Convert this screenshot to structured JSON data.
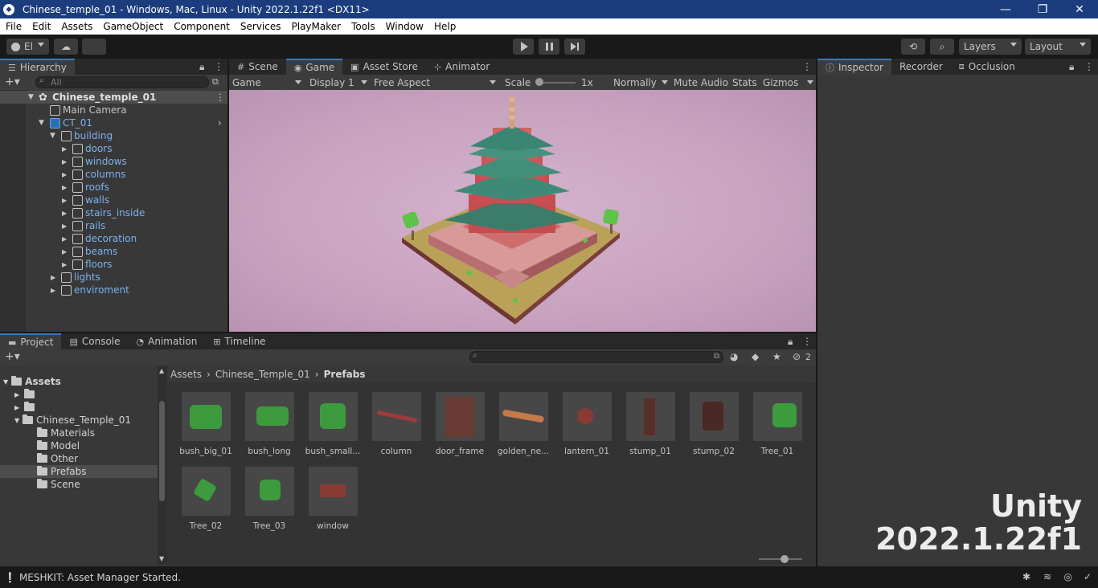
{
  "window": {
    "title": "Chinese_temple_01 - Windows, Mac, Linux - Unity 2022.1.22f1 <DX11>",
    "controls": [
      "—",
      "❐",
      "✕"
    ]
  },
  "menu": [
    "File",
    "Edit",
    "Assets",
    "GameObject",
    "Component",
    "Services",
    "PlayMaker",
    "Tools",
    "Window",
    "Help"
  ],
  "toolbar": {
    "account_label": "El",
    "layers_label": "Layers",
    "layout_label": "Layout"
  },
  "hierarchy": {
    "tab_label": "Hierarchy",
    "search_placeholder": "All",
    "scene_name": "Chinese_temple_01",
    "items": [
      {
        "label": "Main Camera",
        "prefab": false
      },
      {
        "label": "CT_01",
        "prefab": true
      },
      {
        "label": "building",
        "prefab": true
      },
      {
        "label": "doors",
        "prefab": true
      },
      {
        "label": "windows",
        "prefab": true
      },
      {
        "label": "columns",
        "prefab": true
      },
      {
        "label": "roofs",
        "prefab": true
      },
      {
        "label": "walls",
        "prefab": true
      },
      {
        "label": "stairs_inside",
        "prefab": true
      },
      {
        "label": "rails",
        "prefab": true
      },
      {
        "label": "decoration",
        "prefab": true
      },
      {
        "label": "beams",
        "prefab": true
      },
      {
        "label": "floors",
        "prefab": true
      },
      {
        "label": "lights",
        "prefab": true
      },
      {
        "label": "enviroment",
        "prefab": true
      }
    ]
  },
  "center_tabs": {
    "scene": "Scene",
    "game": "Game",
    "asset_store": "Asset Store",
    "animator": "Animator"
  },
  "game_bar": {
    "display_mode": "Game",
    "display": "Display 1",
    "aspect": "Free Aspect",
    "scale_label": "Scale",
    "scale_value": "1x",
    "play_mode": "Normally",
    "mute_audio": "Mute Audio",
    "stats": "Stats",
    "gizmos": "Gizmos"
  },
  "right_tabs": {
    "inspector": "Inspector",
    "recorder": "Recorder",
    "occlusion": "Occlusion"
  },
  "bottom_tabs": {
    "project": "Project",
    "console": "Console",
    "animation": "Animation",
    "timeline": "Timeline",
    "hidden_count": "2"
  },
  "project": {
    "breadcrumb": [
      "Assets",
      "Chinese_Temple_01",
      "Prefabs"
    ],
    "tree_root": "Assets",
    "tree_folder": "Chinese_Temple_01",
    "tree_children": [
      "Materials",
      "Model",
      "Other",
      "Prefabs",
      "Scene"
    ],
    "assets": [
      "bush_big_01",
      "bush_long",
      "bush_small...",
      "column",
      "door_frame",
      "golden_ne...",
      "lantern_01",
      "stump_01",
      "stump_02",
      "Tree_01",
      "Tree_02",
      "Tree_03",
      "window"
    ]
  },
  "status": {
    "message": "MESHKIT: Asset Manager Started."
  },
  "watermark": {
    "line1": "Unity",
    "line2": "2022.1.22f1"
  },
  "colors": {
    "accent": "#3a79bb",
    "titlebar": "#1b3d7e",
    "prefab_blue": "#7cb2f0",
    "game_bg": "#c8a3c0"
  }
}
